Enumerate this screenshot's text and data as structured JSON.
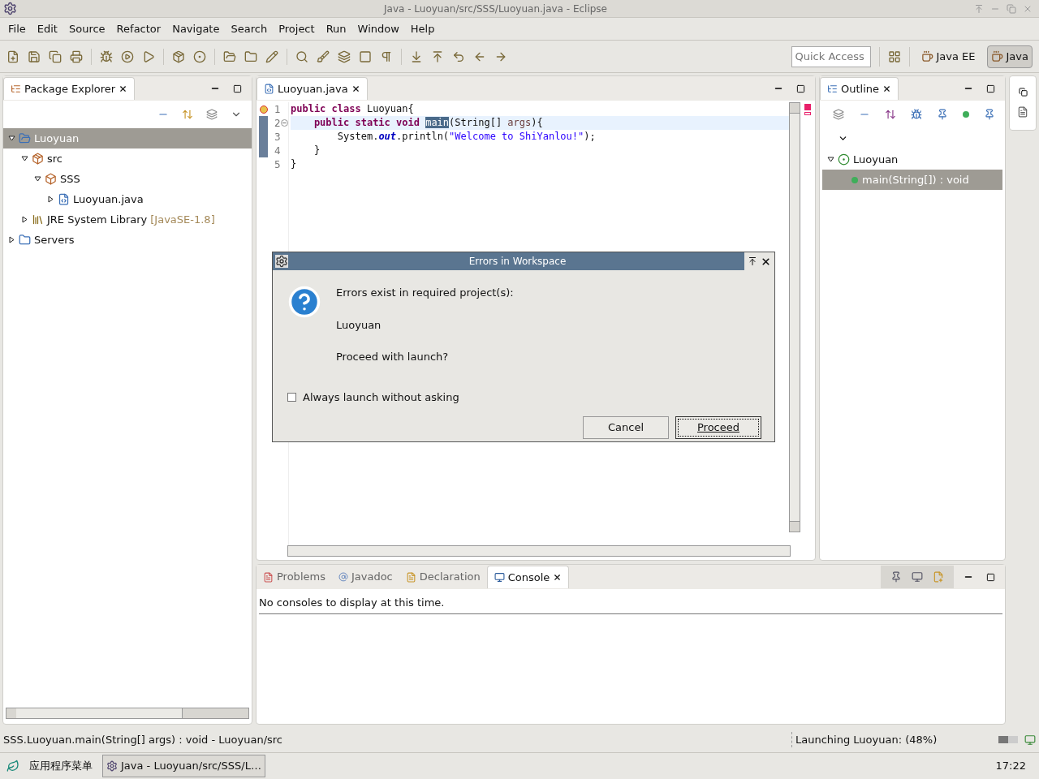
{
  "window": {
    "title": "Java - Luoyuan/src/SSS/Luoyuan.java - Eclipse"
  },
  "menu": [
    "File",
    "Edit",
    "Source",
    "Refactor",
    "Navigate",
    "Search",
    "Project",
    "Run",
    "Window",
    "Help"
  ],
  "quick_access": {
    "placeholder": "Quick Access"
  },
  "perspectives": [
    {
      "label": "Java EE",
      "selected": false
    },
    {
      "label": "Java",
      "selected": true
    }
  ],
  "package_explorer": {
    "tab": "Package Explorer",
    "tree": [
      {
        "label": "Luoyuan",
        "kind": "project",
        "expanded": true,
        "selected": true,
        "children": [
          {
            "label": "src",
            "kind": "source",
            "expanded": true,
            "selected": false,
            "children": [
              {
                "label": "SSS",
                "kind": "package",
                "expanded": true,
                "selected": false,
                "children": [
                  {
                    "label": "Luoyuan.java",
                    "kind": "file",
                    "expanded": false,
                    "selected": false
                  }
                ]
              }
            ]
          },
          {
            "label": "JRE System Library",
            "qualifier": "[JavaSE-1.8]",
            "kind": "library",
            "expanded": false,
            "selected": false
          }
        ]
      },
      {
        "label": "Servers",
        "kind": "folder",
        "expanded": false,
        "selected": false
      }
    ]
  },
  "editor": {
    "tab": "Luoyuan.java",
    "lines": [
      {
        "number": "1",
        "error": true,
        "changed": false,
        "collapse_control": false,
        "current": false,
        "tokens": [
          {
            "kind": "keyword",
            "text": "public class"
          },
          {
            "kind": "plain",
            "text": " Luoyuan{"
          }
        ]
      },
      {
        "number": "2",
        "error": false,
        "changed": true,
        "collapse_control": true,
        "current": true,
        "tokens": [
          {
            "kind": "keyword",
            "text": "    public static void "
          },
          {
            "kind": "highlight",
            "text": "main"
          },
          {
            "kind": "plain",
            "text": "(String[] "
          },
          {
            "kind": "param",
            "text": "args"
          },
          {
            "kind": "plain",
            "text": "){"
          }
        ]
      },
      {
        "number": "3",
        "error": false,
        "changed": true,
        "collapse_control": false,
        "current": false,
        "tokens": [
          {
            "kind": "plain",
            "text": "        System."
          },
          {
            "kind": "field",
            "text": "out"
          },
          {
            "kind": "plain",
            "text": ".println("
          },
          {
            "kind": "string",
            "text": "\"Welcome to ShiYanlou!\""
          },
          {
            "kind": "plain",
            "text": ");"
          }
        ]
      },
      {
        "number": "4",
        "error": false,
        "changed": true,
        "collapse_control": false,
        "current": false,
        "tokens": [
          {
            "kind": "plain",
            "text": "    }"
          }
        ]
      },
      {
        "number": "5",
        "error": false,
        "changed": false,
        "collapse_control": false,
        "current": false,
        "tokens": [
          {
            "kind": "plain",
            "text": "}"
          }
        ]
      }
    ]
  },
  "outline": {
    "tab": "Outline",
    "tree": [
      {
        "label": "Luoyuan",
        "kind": "class",
        "expanded": true,
        "selected": false,
        "children": [
          {
            "label": "main(String[]) : void",
            "kind": "method",
            "selected": true
          }
        ]
      }
    ]
  },
  "bottom_tabs": [
    {
      "label": "Problems",
      "selected": false
    },
    {
      "label": "Javadoc",
      "selected": false
    },
    {
      "label": "Declaration",
      "selected": false
    },
    {
      "label": "Console",
      "selected": true
    }
  ],
  "console": {
    "message": "No consoles to display at this time."
  },
  "dialog": {
    "title": "Errors in Workspace",
    "lines": [
      "Errors exist in required project(s):",
      "Luoyuan",
      "Proceed with launch?"
    ],
    "checkbox": {
      "label": "Always launch without asking",
      "checked": false
    },
    "buttons": [
      {
        "label": "Cancel",
        "default": false
      },
      {
        "label": "Proceed",
        "default": true
      }
    ]
  },
  "status_bar": {
    "selection": "SSS.Luoyuan.main(String[] args) : void - Luoyuan/src",
    "progress": "Launching Luoyuan: (48%)",
    "level": 0.48
  },
  "taskbar": {
    "menu": "应用程序菜单",
    "window": "Java - Luoyuan/src/SSS/L…",
    "clock": "17:22"
  }
}
